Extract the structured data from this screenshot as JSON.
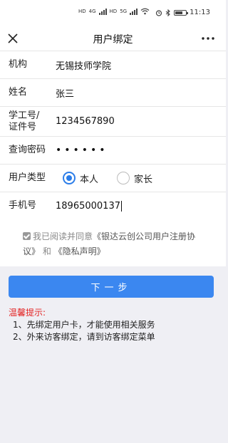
{
  "status_bar": {
    "time": "11:13",
    "left_icons": [
      "HD",
      "4G",
      "HD",
      "5G"
    ]
  },
  "nav": {
    "title": "用户绑定"
  },
  "form": {
    "institution": {
      "label": "机构",
      "value": "无锡技师学院"
    },
    "name": {
      "label": "姓名",
      "value": "张三"
    },
    "student_id": {
      "label_line1": "学工号/",
      "label_line2": "证件号",
      "value": "1234567890"
    },
    "password": {
      "label": "查询密码",
      "value": "••••••"
    },
    "user_type": {
      "label": "用户类型",
      "options": [
        {
          "label": "本人",
          "selected": true
        },
        {
          "label": "家长",
          "selected": false
        }
      ]
    },
    "phone": {
      "label": "手机号",
      "value": "18965000137"
    }
  },
  "agreement": {
    "checked": true,
    "prefix": "我已阅读并同意",
    "terms_link": "《银达云创公司用户注册协议》",
    "conjunction": " 和 ",
    "privacy_link": "《隐私声明》"
  },
  "next_button": {
    "label": "下一步"
  },
  "tips": {
    "title": "温馨提示:",
    "items": [
      "1、先绑定用户卡，才能使用相关服务",
      "2、外来访客绑定，请到访客绑定菜单"
    ]
  },
  "colors": {
    "primary": "#3b87f0",
    "radio_accent": "#2b7de9",
    "tip_title": "#e32020",
    "background": "#efeff4"
  }
}
